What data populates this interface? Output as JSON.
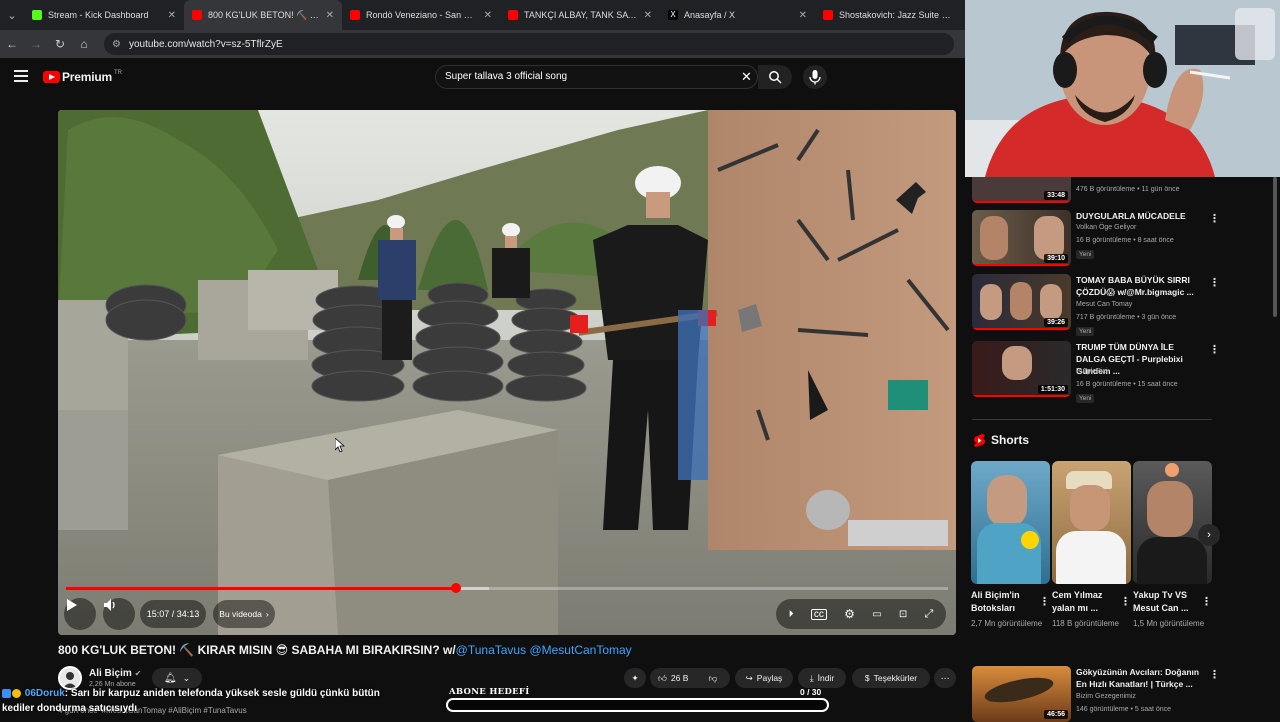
{
  "browser": {
    "tabs": [
      {
        "title": "Stream - Kick Dashboard",
        "color": "#53fc18"
      },
      {
        "title": "800 KG'LUK BETON! ⛏️ KIRAR MISIN",
        "color": "#ff0000"
      },
      {
        "title": "Rondò Veneziano - San Marco",
        "color": "#ff0000"
      },
      {
        "title": "TANKÇI ALBAY, TANK SAVAŞI SA",
        "color": "#ff0000"
      },
      {
        "title": "Anasayfa / X",
        "color": "#ffffff"
      },
      {
        "title": "Shostakovich: Jazz Suite No. 2",
        "color": "#ff0000"
      }
    ],
    "url": "youtube.com/watch?v=sz-5TflrZyE"
  },
  "yt": {
    "brand": "Premium",
    "country": "TR",
    "search_query": "Super tallava 3 official song"
  },
  "player": {
    "time": "15:07 / 34:13",
    "chapter": "Bu videoda",
    "progress": 0.442,
    "buffered": 0.48
  },
  "video": {
    "title_main": "800 KG'LUK BETON! ⛏️ KIRAR MISIN 😎 SABAHA MI BIRAKIRSIN? w/",
    "mention1": "@TunaTavus",
    "mention2": "@MesutCanTomay",
    "channel": "Ali Biçim",
    "subs": "2,26 Mn abone",
    "likes": "26 B",
    "share": "Paylaş",
    "download": "İndir",
    "thanks": "Teşekkürler",
    "desc_prefix": "kediler dondurma satıcısıydı",
    "desc_time": "4 gün önce",
    "tags": "#MesutCanTomay #AliBiçim #TunaTavus"
  },
  "chat": {
    "user": "06Doruk",
    "message": ": Sarı bir karpuz aniden telefonda yüksek sesle güldü çünkü bütün"
  },
  "goal": {
    "label": "ABONE HEDEFİ",
    "count": "0 / 30",
    "progress": 0
  },
  "sidebar": {
    "partial": {
      "line": "476 B görüntüleme • 11 gün önce",
      "duration": "33:48"
    },
    "recs": [
      {
        "title": "DUYGULARLA MÜCADELE",
        "channel": "Volkan Öge Geliyor",
        "meta": "16 B görüntüleme • 8 saat önce",
        "duration": "39:10",
        "badge": "Yeni"
      },
      {
        "title": "TOMAY BABA BÜYÜK SIRRI ÇÖZDÜ😱 w/@Mr.bigmagic ...",
        "channel": "Mesut Can Tomay",
        "meta": "717 B görüntüleme • 3 gün önce",
        "duration": "39:26",
        "badge": "Yeni"
      },
      {
        "title": "TRUMP TÜM DÜNYA İLE DALGA GEÇTİ - Purplebixi Gündem ...",
        "channel": "PurpleBixi",
        "meta": "16 B görüntüleme • 15 saat önce",
        "duration": "1:51:30",
        "badge": "Yeni"
      },
      {
        "title": "Gökyüzünün Avcıları: Doğanın En Hızlı Kanatları! | Türkçe ...",
        "channel": "Bizim Gezegenimiz",
        "meta": "146 görüntüleme • 5 saat önce",
        "duration": "46:56",
        "badge": ""
      }
    ],
    "shorts_title": "Shorts",
    "shorts": [
      {
        "title": "Ali Biçim'in Botoksları",
        "views": "2,7 Mn görüntüleme"
      },
      {
        "title": "Cem Yılmaz yalan mı ...",
        "views": "118 B görüntüleme"
      },
      {
        "title": "Yakup Tv VS Mesut Can ...",
        "views": "1,5 Mn görüntüleme"
      }
    ]
  }
}
